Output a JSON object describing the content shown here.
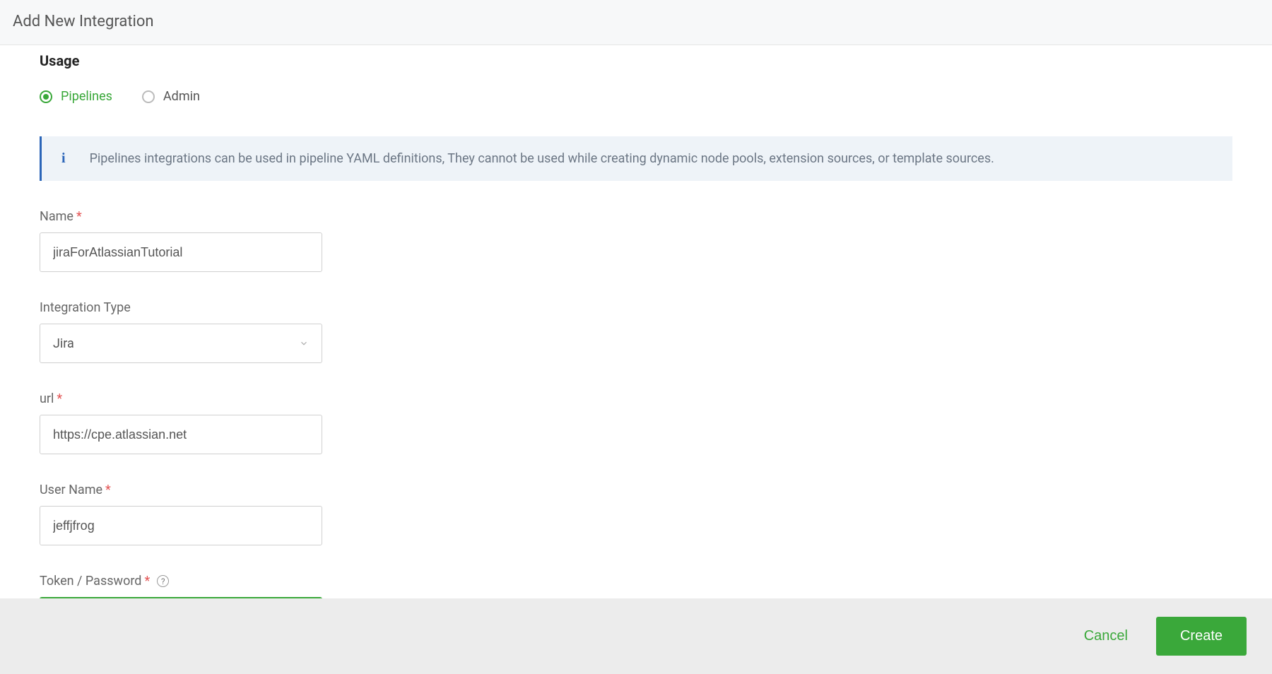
{
  "header": {
    "title": "Add New Integration"
  },
  "usage": {
    "section_label": "Usage",
    "options": [
      {
        "label": "Pipelines",
        "selected": true
      },
      {
        "label": "Admin",
        "selected": false
      }
    ]
  },
  "info_banner": {
    "icon": "i",
    "text": "Pipelines integrations can be used in pipeline YAML definitions, They cannot be used while creating dynamic node pools, extension sources, or template sources."
  },
  "fields": {
    "name": {
      "label": "Name",
      "required": true,
      "value": "jiraForAtlassianTutorial"
    },
    "integration_type": {
      "label": "Integration Type",
      "required": false,
      "selected": "Jira"
    },
    "url": {
      "label": "url",
      "required": true,
      "value": "https://cpe.atlassian.net"
    },
    "user_name": {
      "label": "User Name",
      "required": true,
      "value": "jeffjfrog"
    },
    "token": {
      "label": "Token / Password",
      "required": true,
      "has_help": true,
      "value": "•••••••••",
      "focused": true
    }
  },
  "footer": {
    "cancel": "Cancel",
    "create": "Create"
  }
}
